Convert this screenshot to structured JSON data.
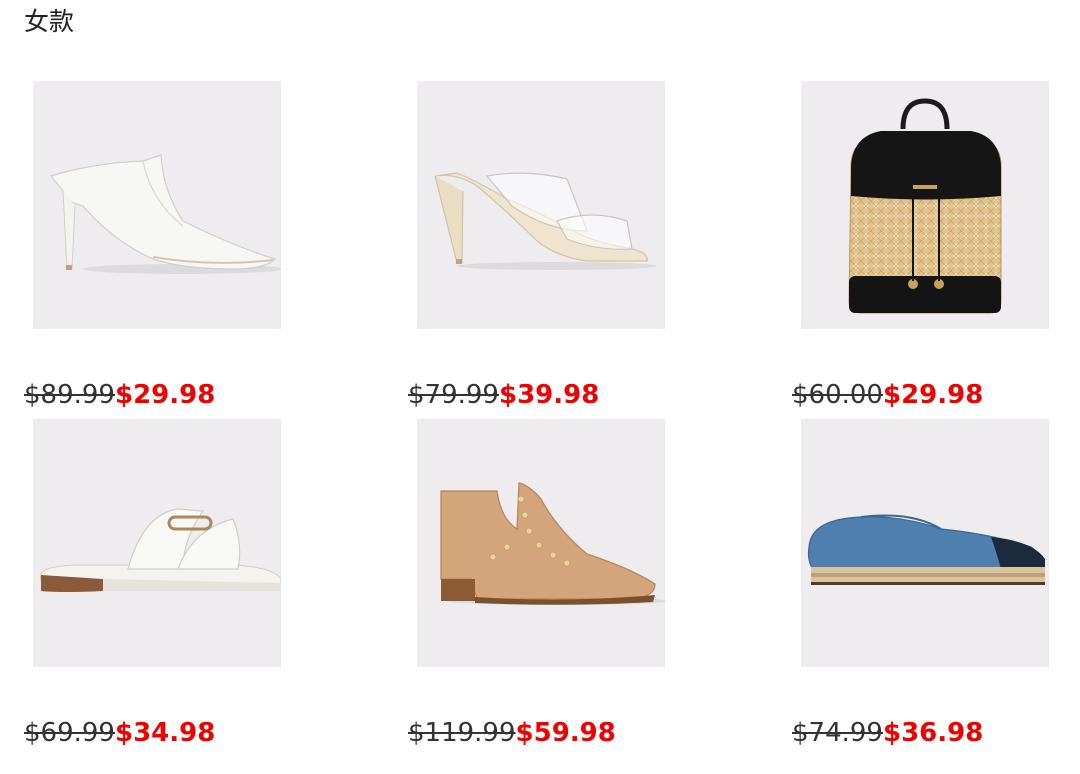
{
  "section": {
    "title": "女款"
  },
  "products": [
    {
      "image": "white-pointed-mule-heel",
      "old_price": "$89.99",
      "new_price": "$29.98"
    },
    {
      "image": "clear-strap-heeled-sandal",
      "old_price": "$79.99",
      "new_price": "$39.98"
    },
    {
      "image": "rattan-flap-backpack",
      "old_price": "$60.00",
      "new_price": "$29.98"
    },
    {
      "image": "white-buckle-slide-sandal",
      "old_price": "$69.99",
      "new_price": "$34.98"
    },
    {
      "image": "tan-studded-ankle-boot",
      "old_price": "$119.99",
      "new_price": "$59.98"
    },
    {
      "image": "denim-espadrille-slip-on",
      "old_price": "$74.99",
      "new_price": "$36.98"
    }
  ],
  "colors": {
    "image_bg": "#eeecef",
    "old_price": "#333333",
    "sale_price": "#f20000"
  }
}
